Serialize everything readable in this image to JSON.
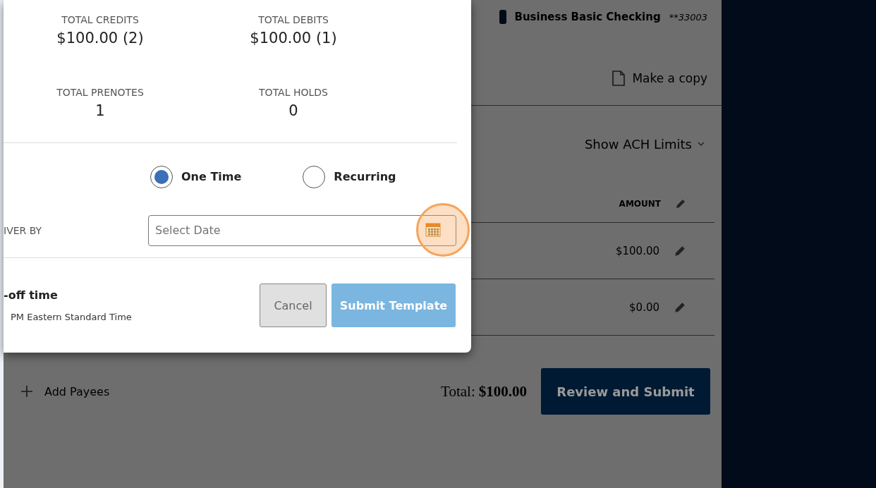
{
  "account": {
    "name": "Business Basic Checking",
    "number": "**33003"
  },
  "copy_link": "Make a copy",
  "limits_toggle": "Show ACH Limits",
  "table": {
    "columns": [
      {
        "label": "AMOUNT"
      }
    ],
    "rows": [
      {
        "amount": "$100.00"
      },
      {
        "amount": "$0.00"
      }
    ]
  },
  "footer": {
    "add_payees": "Add Payees",
    "total_label": "Total:",
    "total_value": "$100.00",
    "submit": "Review and Submit"
  },
  "dialog": {
    "stats": [
      {
        "label": "TOTAL CREDITS",
        "value": "$100.00 (2)"
      },
      {
        "label": "TOTAL DEBITS",
        "value": "$100.00 (1)"
      },
      {
        "label": "TOTAL PRENOTES",
        "value": "1"
      },
      {
        "label": "TOTAL HOLDS",
        "value": "0"
      }
    ],
    "frequency": [
      {
        "label": "One Time",
        "selected": true
      },
      {
        "label": "Recurring",
        "selected": false
      }
    ],
    "date_field": {
      "label": "IVER BY",
      "placeholder": "Select Date"
    },
    "cutoff": {
      "title": "-off time",
      "detail": "PM Eastern Standard Time"
    },
    "buttons": [
      {
        "label": "Cancel",
        "kind": "secondary"
      },
      {
        "label": "Submit Template",
        "kind": "primary"
      }
    ]
  }
}
